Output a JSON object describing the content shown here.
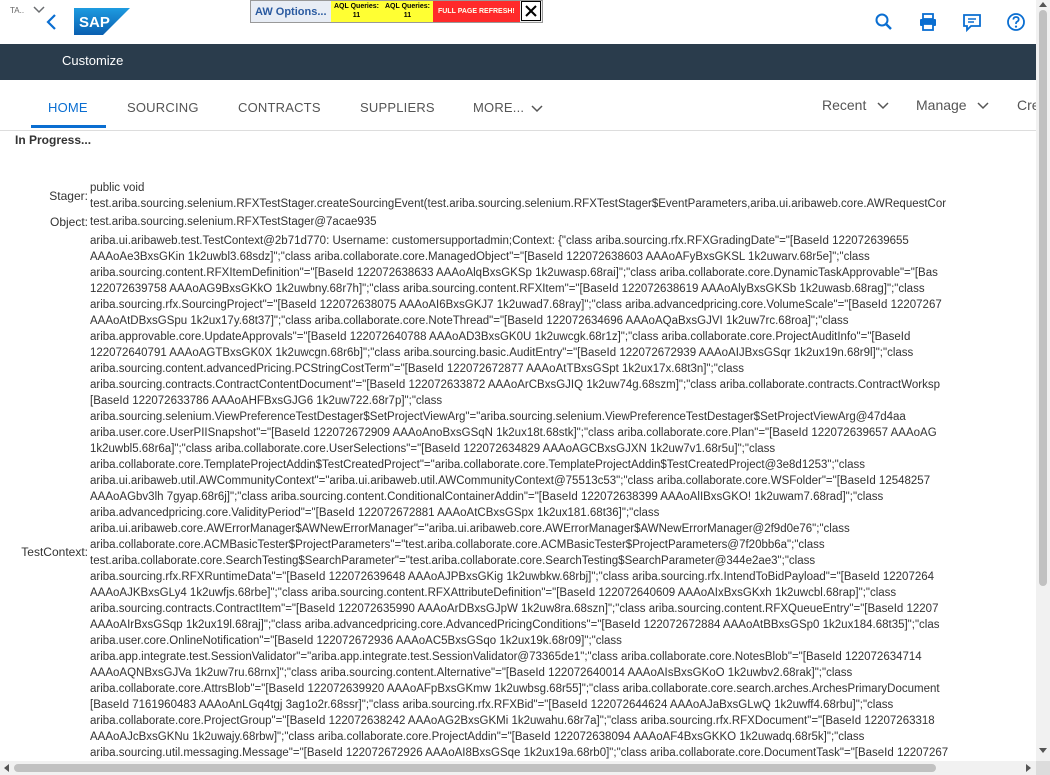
{
  "header": {
    "tiny_label": "TA..",
    "logo_text": "SAP",
    "aw_options": "AW Options...",
    "aql_1": [
      "AQL Queries:",
      "11"
    ],
    "aql_2": [
      "AQL Queries:",
      "11"
    ],
    "refresh": "FULL PAGE REFRESH!"
  },
  "darkbar": {
    "customize": "Customize"
  },
  "tabs": [
    {
      "label": "HOME",
      "active": true
    },
    {
      "label": "SOURCING"
    },
    {
      "label": "CONTRACTS"
    },
    {
      "label": "SUPPLIERS"
    },
    {
      "label": "MORE..."
    }
  ],
  "right_menus": [
    "Recent",
    "Manage",
    "Cre"
  ],
  "status": "In Progress...",
  "rows": {
    "stager_label": "Stager:",
    "stager_lines": [
      "public void",
      "test.ariba.sourcing.selenium.RFXTestStager.createSourcingEvent(test.ariba.sourcing.selenium.RFXTestStager$EventParameters,ariba.ui.aribaweb.core.AWRequestCor"
    ],
    "object_label": "Object:",
    "object_value": "test.ariba.sourcing.selenium.RFXTestStager@7acae935",
    "testcontext_label": "TestContext:",
    "testcontext_lines": [
      "ariba.ui.aribaweb.test.TestContext@2b71d770: Username: customersupportadmin;Context: {\"class ariba.sourcing.rfx.RFXGradingDate\"=\"[BaseId 122072639655",
      "AAAoAe3BxsGKin 1k2uwbl3.68sdz]\";\"class ariba.collaborate.core.ManagedObject\"=\"[BaseId 122072638603 AAAoAFyBxsGKSL 1k2uwarv.68r5e]\";\"class",
      "ariba.sourcing.content.RFXItemDefinition\"=\"[BaseId 122072638633 AAAoAlqBxsGKSp 1k2uwasp.68rai]\";\"class ariba.collaborate.core.DynamicTaskApprovable\"=\"[Bas",
      "122072639758 AAAoAG9BxsGKkO 1k2uwbny.68r7h]\";\"class ariba.sourcing.content.RFXItem\"=\"[BaseId 122072638619 AAAoAlyBxsGKSb 1k2uwasb.68rag]\";\"class",
      "ariba.sourcing.rfx.SourcingProject\"=\"[BaseId 122072638075 AAAoAI6BxsGKJ7 1k2uwad7.68ray]\";\"class ariba.advancedpricing.core.VolumeScale\"=\"[BaseId 12207267",
      "AAAoAtDBxsGSpu 1k2ux17y.68t37]\";\"class ariba.collaborate.core.NoteThread\"=\"[BaseId 122072634696 AAAoAQaBxsGJVI 1k2uw7rc.68roa]\";\"class",
      "ariba.approvable.core.UpdateApprovals\"=\"[BaseId 122072640788 AAAoAD3BxsGK0U 1k2uwcgk.68r1z]\";\"class ariba.collaborate.core.ProjectAuditInfo\"=\"[BaseId",
      "122072640791 AAAoAGTBxsGK0X 1k2uwcgn.68r6b]\";\"class ariba.sourcing.basic.AuditEntry\"=\"[BaseId 122072672939 AAAoAIJBxsGSqr 1k2ux19n.68r9l]\";\"class",
      "ariba.sourcing.content.advancedPricing.PCStringCostTerm\"=\"[BaseId 122072672877 AAAoAtTBxsGSpt 1k2ux17x.68t3n]\";\"class",
      "ariba.sourcing.contracts.ContractContentDocument\"=\"[BaseId 122072633872 AAAoArCBxsGJIQ 1k2uw74g.68szm]\";\"class ariba.collaborate.contracts.ContractWorksp",
      "[BaseId 122072633786 AAAoAHFBxsGJG6 1k2uw722.68r7p]\";\"class",
      "ariba.sourcing.selenium.ViewPreferenceTestDestager$SetProjectViewArg\"=\"ariba.sourcing.selenium.ViewPreferenceTestDestager$SetProjectViewArg@47d4aa",
      "ariba.user.core.UserPIISnapshot\"=\"[BaseId 122072672909 AAAoAnoBxsGSqN 1k2ux18t.68stk]\";\"class ariba.collaborate.core.Plan\"=\"[BaseId 122072639657 AAAoAG",
      "1k2uwbl5.68r6a]\";\"class ariba.collaborate.core.UserSelections\"=\"[BaseId 122072634829 AAAoAGCBxsGJXN 1k2uw7v1.68r5u]\";\"class",
      "ariba.collaborate.core.TemplateProjectAddin$TestCreatedProject\"=\"ariba.collaborate.core.TemplateProjectAddin$TestCreatedProject@3e8d1253\";\"class",
      "ariba.ui.aribaweb.util.AWCommunityContext\"=\"ariba.ui.aribaweb.util.AWCommunityContext@75513c53\";\"class ariba.collaborate.core.WSFolder\"=\"[BaseId 12548257",
      "AAAoAGbv3lh 7gyap.68r6j]\";\"class ariba.sourcing.content.ConditionalContainerAddin\"=\"[BaseId 122072638399 AAAoAlIBxsGKO! 1k2uwam7.68rad]\";\"class",
      "ariba.advancedpricing.core.ValidityPeriod\"=\"[BaseId 122072672881 AAAoAtCBxsGSpx 1k2ux181.68t36]\";\"class",
      "ariba.ui.aribaweb.core.AWErrorManager$AWNewErrorManager\"=\"ariba.ui.aribaweb.core.AWErrorManager$AWNewErrorManager@2f9d0e76\";\"class",
      "ariba.collaborate.core.ACMBasicTester$ProjectParameters\"=\"test.ariba.collaborate.core.ACMBasicTester$ProjectParameters@7f20bb6a\";\"class",
      "test.ariba.collaborate.core.SearchTesting$SearchParameter\"=\"test.ariba.collaborate.core.SearchTesting$SearchParameter@344e2ae3\";\"class",
      "ariba.sourcing.rfx.RFXRuntimeData\"=\"[BaseId 122072639648 AAAoAJPBxsGKig 1k2uwbkw.68rbj]\";\"class ariba.sourcing.rfx.IntendToBidPayload\"=\"[BaseId 12207264",
      "AAAoAJKBxsGLy4 1k2uwfjs.68rbe]\";\"class ariba.sourcing.content.RFXAttributeDefinition\"=\"[BaseId 122072640609 AAAoAIxBxsGKxh 1k2uwcbl.68rap]\";\"class",
      "ariba.sourcing.contracts.ContractItem\"=\"[BaseId 122072635990 AAAoArDBxsGJpW 1k2uw8ra.68szn]\";\"class ariba.sourcing.content.RFXQueueEntry\"=\"[BaseId 12207",
      "AAAoAIrBxsGSqp 1k2ux19l.68raj]\";\"class ariba.advancedpricing.core.AdvancedPricingConditions\"=\"[BaseId 122072672884 AAAoAtBBxsGSp0 1k2ux184.68t35]\";\"clas",
      "ariba.user.core.OnlineNotification\"=\"[BaseId 122072672936 AAAoAC5BxsGSqo 1k2ux19k.68r09]\";\"class",
      "ariba.app.integrate.test.SessionValidator\"=\"ariba.app.integrate.test.SessionValidator@73365de1\";\"class ariba.collaborate.core.NotesBlob\"=\"[BaseId 122072634714",
      "AAAoAQNBxsGJVa 1k2uw7ru.68rnx]\";\"class ariba.sourcing.content.Alternative\"=\"[BaseId 122072640014 AAAoAIsBxsGKoO 1k2uwbv2.68rak]\";\"class",
      "ariba.collaborate.core.AttrsBlob\"=\"[BaseId 122072639920 AAAoAFpBxsGKmw 1k2uwbsg.68r55]\";\"class ariba.collaborate.core.search.arches.ArchesPrimaryDocument",
      "[BaseId 7161960483 AAAoAnLGq4tgj 3ag1o2r.68ssr]\";\"class ariba.sourcing.rfx.RFXBid\"=\"[BaseId 122072644624 AAAoAJaBxsGLwQ 1k2uwff4.68rbu]\";\"class",
      "ariba.collaborate.core.ProjectGroup\"=\"[BaseId 122072638242 AAAoAG2BxsGKMi 1k2uwahu.68r7a]\";\"class ariba.sourcing.rfx.RFXDocument\"=\"[BaseId 12207263318",
      "AAAoAJcBxsGKNu 1k2uwajy.68rbw]\";\"class ariba.collaborate.core.ProjectAddin\"=\"[BaseId 122072638094 AAAoAF4BxsGKKO 1k2uwadq.68r5k]\";\"class",
      "ariba.sourcing.util.messaging.Message\"=\"[BaseId 122072672926 AAAoAI8BxsGSqe 1k2ux19a.68rb0]\";\"class ariba.collaborate.core.DocumentTask\"=\"[BaseId 12207267"
    ]
  },
  "colors": {
    "primary": "#0a6ed1",
    "dark_bar": "#2a3c4c",
    "refresh_bg": "#ff2a2a",
    "aql_bg": "#ffff33"
  }
}
